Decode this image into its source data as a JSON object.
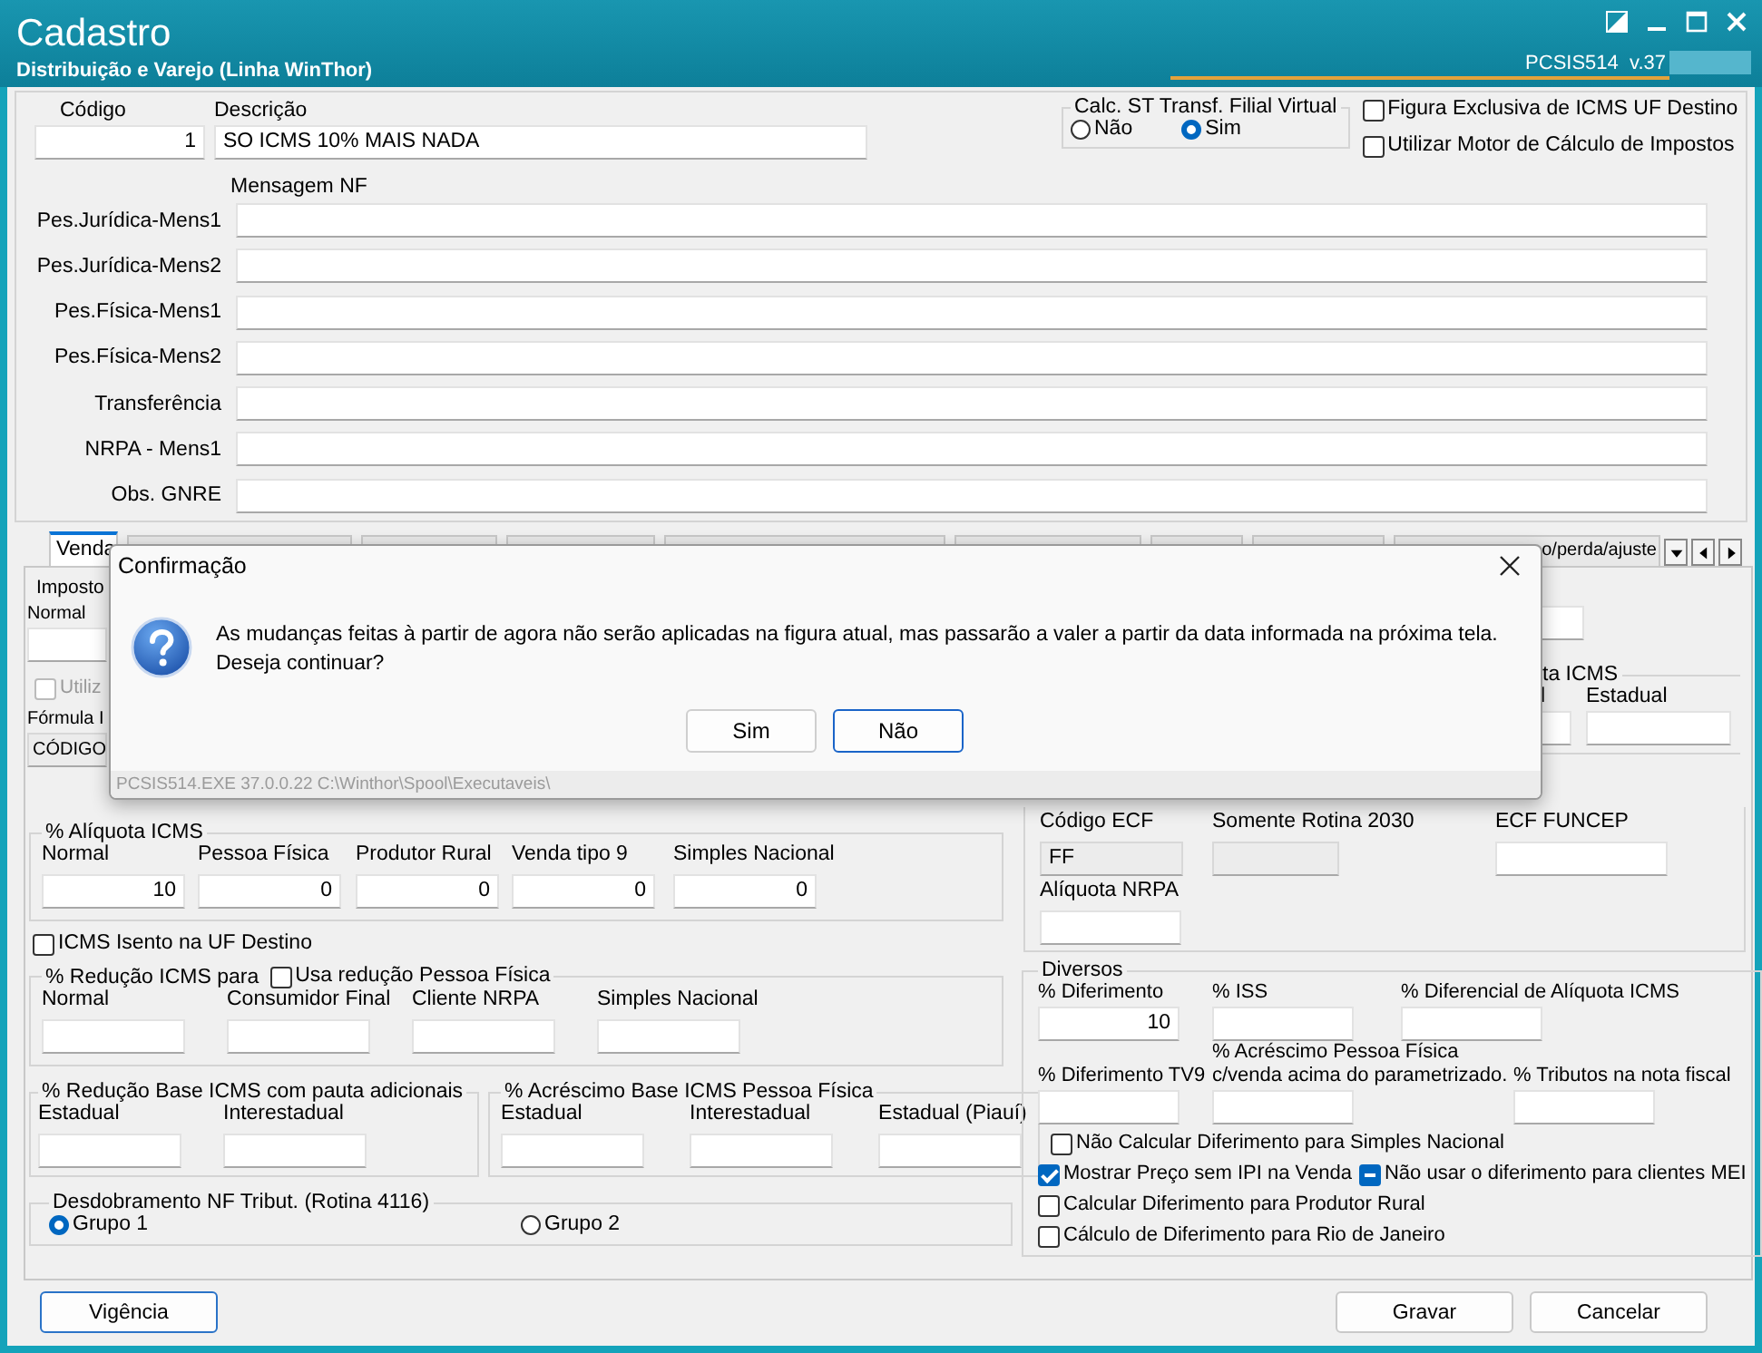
{
  "window": {
    "title": "Cadastro",
    "subtitle": "Distribuição e Varejo (Linha WinThor)",
    "version": "PCSIS514  v.37"
  },
  "header": {
    "codigo": {
      "label": "Código",
      "value": "1"
    },
    "descricao": {
      "label": "Descrição",
      "value": "SO ICMS 10% MAIS NADA"
    },
    "calc_st": {
      "title": "Calc. ST Transf. Filial Virtual",
      "options": [
        {
          "label": "Não",
          "selected": false
        },
        {
          "label": "Sim",
          "selected": true
        }
      ]
    },
    "checks": [
      {
        "label": "Figura Exclusiva de ICMS UF Destino",
        "checked": false
      },
      {
        "label": "Utilizar Motor de Cálculo de Impostos",
        "checked": false
      }
    ]
  },
  "mensagem_nf": {
    "title": "Mensagem NF",
    "rows": [
      {
        "label": "Pes.Jurídica-Mens1"
      },
      {
        "label": "Pes.Jurídica-Mens2"
      },
      {
        "label": "Pes.Física-Mens1"
      },
      {
        "label": "Pes.Física-Mens2"
      },
      {
        "label": "Transferência"
      },
      {
        "label": "NRPA - Mens1"
      },
      {
        "label": "Obs. GNRE"
      }
    ]
  },
  "tabs": [
    {
      "label": "Venda",
      "selected": true
    },
    {
      "label": "o/perda/ajuste",
      "selected": false
    }
  ],
  "covered_left": {
    "group": "Imposto",
    "label": "Normal",
    "check": {
      "label": "Utiliz",
      "checked": false,
      "disabled": true
    },
    "formula_label": "Fórmula I",
    "formula_value": "CÓDIGO"
  },
  "covered_right": {
    "group": "ta ICMS",
    "labels": [
      "l",
      "Estadual"
    ]
  },
  "aliquota_icms": {
    "title": "% Alíquota ICMS",
    "fields": [
      {
        "label": "Normal",
        "value": "10"
      },
      {
        "label": "Pessoa Física",
        "value": "0"
      },
      {
        "label": "Produtor Rural",
        "value": "0"
      },
      {
        "label": "Venda tipo 9",
        "value": "0"
      },
      {
        "label": "Simples Nacional",
        "value": "0"
      }
    ]
  },
  "icms_isento": {
    "label": "ICMS Isento na UF Destino",
    "checked": false
  },
  "reducao_icms": {
    "title": "% Redução ICMS para",
    "check": {
      "label": "Usa redução Pessoa Física",
      "checked": false
    },
    "fields": [
      {
        "label": "Normal"
      },
      {
        "label": "Consumidor Final"
      },
      {
        "label": "Cliente NRPA"
      },
      {
        "label": "Simples Nacional"
      }
    ]
  },
  "reducao_base": {
    "title": "% Redução Base ICMS com pauta adicionais",
    "fields": [
      {
        "label": "Estadual"
      },
      {
        "label": "Interestadual"
      }
    ]
  },
  "acrescimo_base": {
    "title": "% Acréscimo Base ICMS Pessoa Física",
    "fields": [
      {
        "label": "Estadual"
      },
      {
        "label": "Interestadual"
      },
      {
        "label": "Estadual (Piauí)"
      }
    ]
  },
  "desdobramento": {
    "title": "Desdobramento NF Tribut. (Rotina 4116)",
    "options": [
      {
        "label": "Grupo 1",
        "selected": true
      },
      {
        "label": "Grupo 2",
        "selected": false
      }
    ]
  },
  "ecf": {
    "fields": [
      {
        "label": "Código ECF",
        "value": "FF",
        "disabled": true
      },
      {
        "label": "Somente Rotina 2030",
        "disabled": true
      },
      {
        "label": "ECF FUNCEP",
        "disabled": false
      },
      {
        "label": "Alíquota NRPA",
        "disabled": false
      }
    ]
  },
  "diversos": {
    "title": "Diversos",
    "fields": [
      {
        "label": "% Diferimento",
        "value": "10"
      },
      {
        "label": "% ISS"
      },
      {
        "label": "% Diferencial de Alíquota ICMS"
      },
      {
        "label": "% Diferimento TV9"
      },
      {
        "label": "% Acréscimo Pessoa Física\nc/venda acima do parametrizado."
      },
      {
        "label": "% Tributos na nota fiscal"
      }
    ],
    "checks": [
      {
        "kind": "check",
        "label": "Não Calcular Diferimento para Simples Nacional",
        "checked": false
      },
      {
        "kind": "check",
        "label": "Mostrar Preço sem IPI na Venda",
        "checked": true
      },
      {
        "kind": "tristate",
        "label": "Não usar o diferimento para clientes MEI",
        "checked": true
      },
      {
        "kind": "check",
        "label": "Calcular Diferimento para Produtor Rural",
        "checked": false
      },
      {
        "kind": "check",
        "label": "Cálculo de Diferimento para Rio de Janeiro",
        "checked": false
      }
    ]
  },
  "buttons": [
    {
      "label": "Vigência",
      "focused": true
    },
    {
      "label": "Gravar",
      "focused": false
    },
    {
      "label": "Cancelar",
      "focused": false
    }
  ],
  "dialog": {
    "title": "Confirmação",
    "message": "As mudanças feitas à partir de agora não serão aplicadas na figura atual, mas passarão a valer a partir da data informada na próxima tela.\nDeseja continuar?",
    "buttons": [
      {
        "label": "Sim",
        "focused": false
      },
      {
        "label": "Não",
        "focused": true
      }
    ],
    "footer": "PCSIS514.EXE 37.0.0.22 C:\\Winthor\\Spool\\Executaveis\\"
  }
}
